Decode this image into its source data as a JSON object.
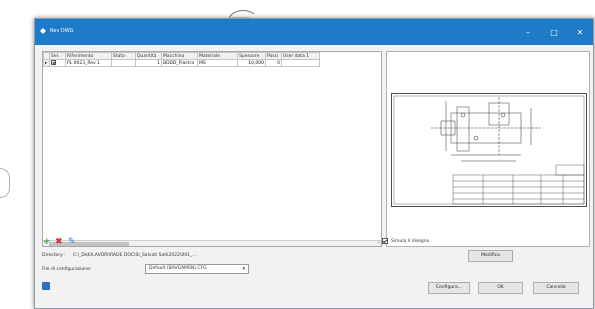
{
  "window": {
    "title": "Rev DWG"
  },
  "grid": {
    "columns": [
      "Sel.",
      "Riferimento",
      "Stato",
      "Quantità",
      "Macchina",
      "Materiale",
      "Spessore",
      "Passi",
      "User data 1"
    ],
    "rows": [
      {
        "selected": true,
        "riferimento": "PL 0023_Rev 1",
        "stato": "",
        "quantita": "1",
        "macchina": "BDDD_Piastra",
        "materiale": "MS",
        "spessore": "10,000",
        "passi": "0",
        "userdata1": ""
      }
    ]
  },
  "labels": {
    "simula": "Simula il disegno",
    "modifica": "Modifica",
    "directory_label": "Directory :",
    "directory_value": "C:\\_Dati\\LAVORI\\RADE DOC\\SI_Salvati Salti2022\\001_...",
    "config_label": "File di configurazione:",
    "config_value": "Default (BAVGAMSN).CFG",
    "configura": "Configura...",
    "ok": "OK",
    "cancel": "Cancella"
  },
  "icons": {
    "add": "plus-icon",
    "remove": "delete-icon",
    "edit": "edit-icon",
    "help": "help-icon"
  },
  "colors": {
    "titlebar": "#1e7bc7",
    "add": "#3aa33a",
    "remove": "#d62b2b",
    "edit": "#3b7ed6"
  }
}
